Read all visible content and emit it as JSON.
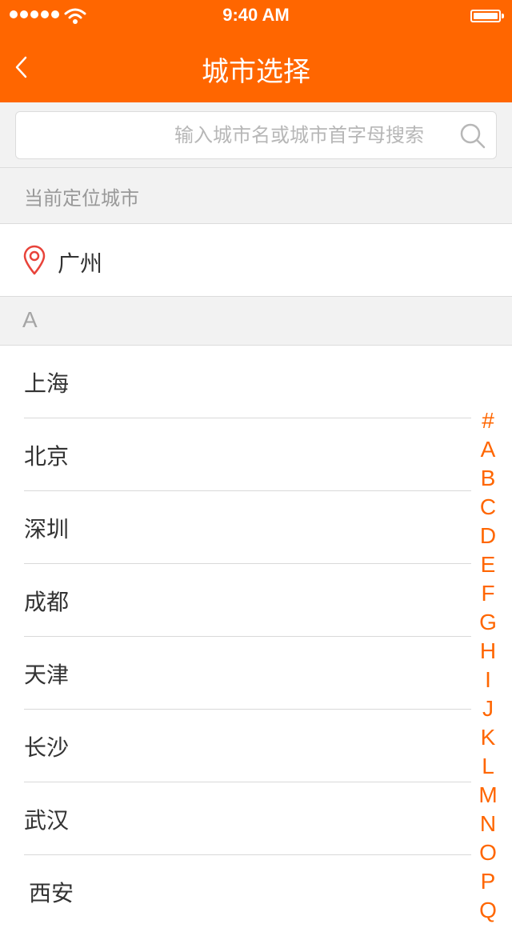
{
  "status_bar": {
    "time": "9:40 AM"
  },
  "nav": {
    "title": "城市选择"
  },
  "search": {
    "placeholder": "输入城市名或城市首字母搜索",
    "value": ""
  },
  "current_location": {
    "header": "当前定位城市",
    "city": "广州"
  },
  "sections": [
    {
      "letter": "A",
      "cities": [
        "上海",
        "北京",
        "深圳",
        "成都",
        "天津",
        "长沙",
        "武汉",
        "西安"
      ]
    }
  ],
  "index_letters": [
    "#",
    "A",
    "B",
    "C",
    "D",
    "E",
    "F",
    "G",
    "H",
    "I",
    "J",
    "K",
    "L",
    "M",
    "N",
    "O",
    "P",
    "Q"
  ],
  "colors": {
    "accent": "#ff6600",
    "pin": "#e8433a"
  }
}
